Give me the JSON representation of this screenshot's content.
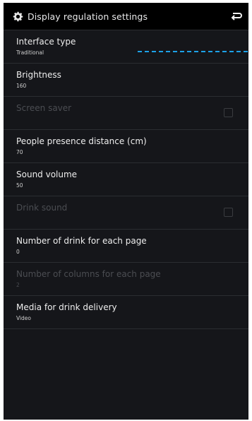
{
  "header": {
    "title": "Display regulation settings",
    "settings_icon": "gear-icon",
    "back_icon": "return-arrow-icon"
  },
  "items": [
    {
      "label": "Interface type",
      "value": "Traditional",
      "enabled": true
    },
    {
      "label": "Brightness",
      "value": "160",
      "enabled": true
    },
    {
      "label": "Screen saver",
      "value": "",
      "enabled": false,
      "checkbox": true
    },
    {
      "label": "People presence distance (cm)",
      "value": "70",
      "enabled": true
    },
    {
      "label": "Sound volume",
      "value": "50",
      "enabled": true
    },
    {
      "label": "Drink sound",
      "value": "",
      "enabled": false,
      "checkbox": true
    },
    {
      "label": "Number of drink for each page",
      "value": "0",
      "enabled": true
    },
    {
      "label": "Number of columns for each page",
      "value": "2",
      "enabled": false
    },
    {
      "label": "Media for drink delivery",
      "value": "Video",
      "enabled": true
    }
  ],
  "colors": {
    "background": "#15161a",
    "header": "#000000",
    "accent_dashes": "#1da1e8"
  }
}
